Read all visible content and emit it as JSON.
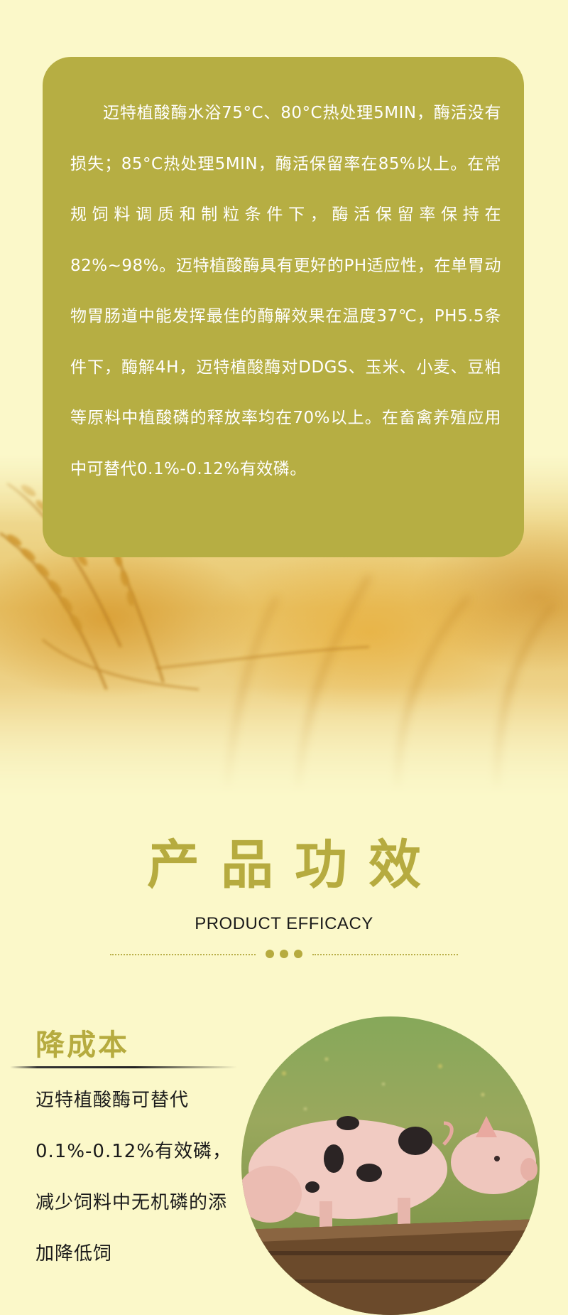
{
  "intro": {
    "paragraph": "迈特植酸酶水浴75°C、80°C热处理5MIN，酶活没有损失；85°C热处理5MIN，酶活保留率在85%以上。在常规饲料调质和制粒条件下，酶活保留率保持在82%~98%。迈特植酸酶具有更好的PH适应性，在单胃动物胃肠道中能发挥最佳的酶解效果在温度37℃，PH5.5条件下，酶解4H，迈特植酸酶对DDGS、玉米、小麦、豆粕等原料中植酸磷的释放率均在70%以上。在畜禽养殖应用中可替代0.1%-0.12%有效磷。"
  },
  "section": {
    "title": "产品功效",
    "subtitle": "PRODUCT EFFICACY"
  },
  "feature": {
    "heading": "降成本",
    "text": "迈特植酸酶可替代0.1%-0.12%有效磷，减少饲料中无机磷的添加降低饲"
  },
  "colors": {
    "panel": "#b6ae43",
    "accent": "#b6ab3f",
    "background": "#fbf8c9"
  }
}
